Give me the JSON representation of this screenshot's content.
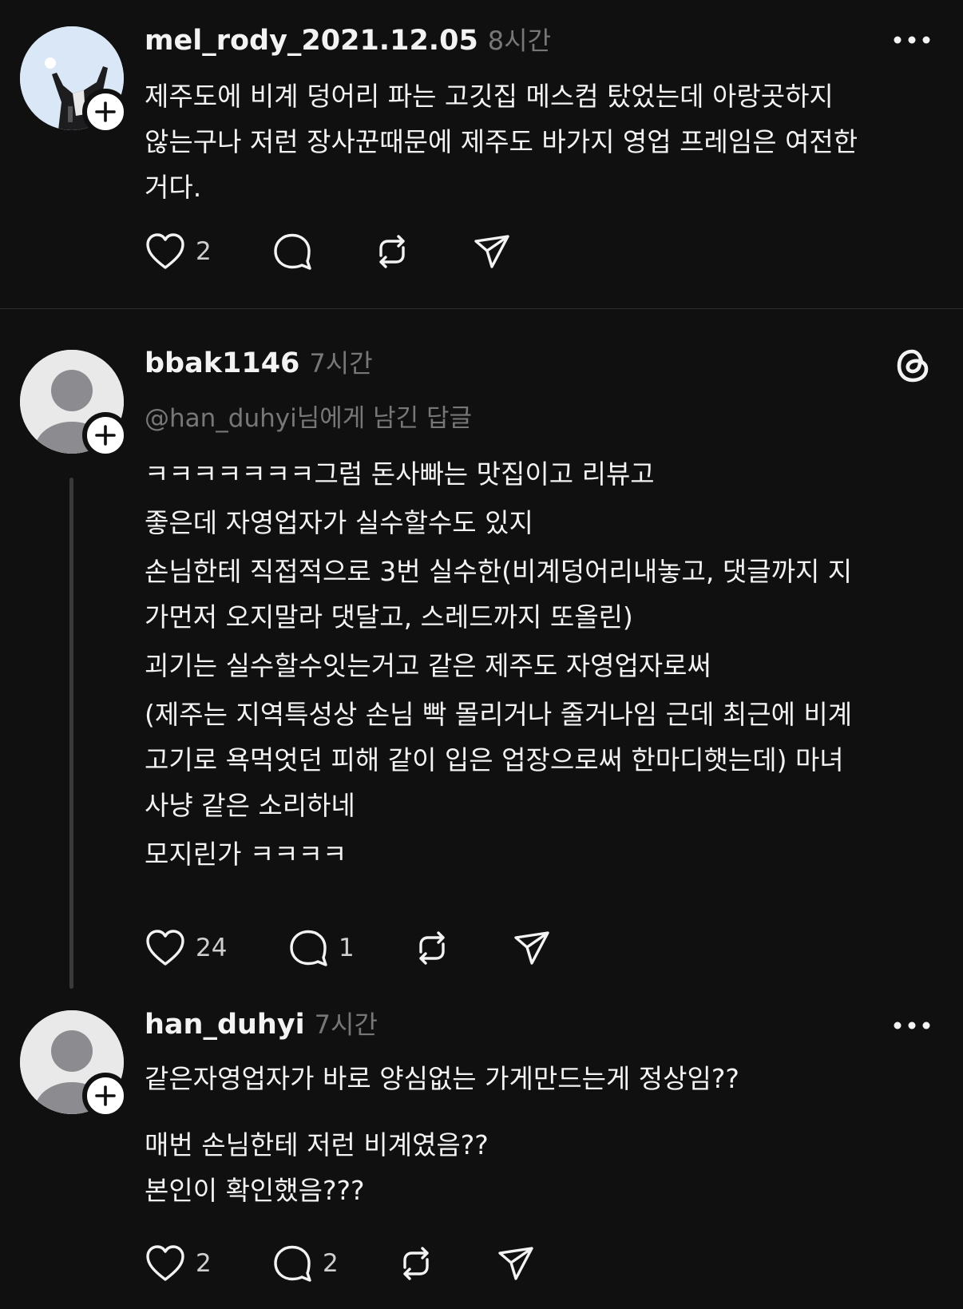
{
  "posts": [
    {
      "username": "mel_rody_2021.12.05",
      "time": "8시간",
      "lines": [
        "제주도에 비계 덩어리 파는 고깃집 메스컴 탔었는데 아랑곳하지",
        "않는구나 저런 장사꾼때문에 제주도 바가지 영업 프레임은 여전한",
        "거다."
      ],
      "likes": "2",
      "replies": "",
      "avatar": "photo-avatar",
      "menu_icon": "more-icon"
    },
    {
      "username": "bbak1146",
      "time": "7시간",
      "reply_to": "@han_duhyi님에게 남긴 답글",
      "lines": [
        "ㅋㅋㅋㅋㅋㅋㅋ그럼 돈사빠는 맛집이고 리뷰고",
        "좋은데 자영업자가 실수할수도 있지",
        "손님한테 직접적으로 3번 실수한(비계덩어리내놓고, 댓글까지 지",
        "가먼저 오지말라 댓달고, 스레드까지 또올린)",
        "괴기는 실수할수잇는거고 같은 제주도 자영업자로써",
        "(제주는 지역특성상 손님 빡 몰리거나 줄거나임 근데 최근에 비계",
        "고기로 욕먹엇던 피해 같이 입은 업장으로써 한마디햇는데) 마녀",
        "사냥 같은 소리하네",
        "모지린가 ㅋㅋㅋㅋ"
      ],
      "likes": "24",
      "replies": "1",
      "avatar": "default-avatar",
      "menu_icon": "threads-logo-icon"
    },
    {
      "username": "han_duhyi",
      "time": "7시간",
      "lines": [
        "같은자영업자가 바로 양심없는 가게만드는게 정상임??",
        "매번 손님한테 저런 비계였음??",
        "본인이 확인했음???"
      ],
      "likes": "2",
      "replies": "2",
      "avatar": "default-avatar",
      "menu_icon": "more-icon"
    }
  ],
  "colors": {
    "background": "#101010",
    "text": "#f3f3f3",
    "muted": "#777777",
    "icon": "#f3f3f3"
  }
}
